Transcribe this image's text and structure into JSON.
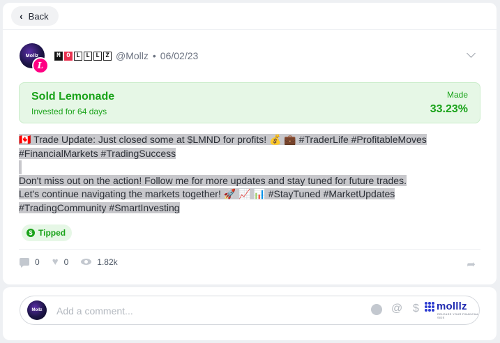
{
  "nav": {
    "back_label": "Back"
  },
  "post": {
    "author_handle": "@Mollz",
    "separator": "•",
    "date": "06/02/23",
    "name_glyphs": [
      "M",
      "O",
      "L",
      "L",
      "L",
      "Z"
    ],
    "avatar_text": "Mollz"
  },
  "result": {
    "title": "Sold Lemonade",
    "subtitle": "Invested for 64 days",
    "made_label": "Made",
    "made_value": "33.23%"
  },
  "body": {
    "line1": "🇨🇦 Trade Update: Just closed some at $LMND for profits! 💰 💼 #TraderLife #ProfitableMoves",
    "line2": "#FinancialMarkets #TradingSuccess",
    "line3": "Don't miss out on the action! Follow me for more updates and stay tuned for future trades.",
    "line4": "Let's continue navigating the markets together! 🚀 📈 📊 #StayTuned #MarketUpdates",
    "line5": "#TradingCommunity #SmartInvesting"
  },
  "tip": {
    "label": "Tipped",
    "icon": "dollar-icon"
  },
  "stats": {
    "comments": "0",
    "likes": "0",
    "views": "1.82k"
  },
  "comment": {
    "placeholder": "Add a comment...",
    "brand_name": "molllz",
    "brand_tagline": "RELEASE YOUR FINANCIAL SIDE"
  },
  "colors": {
    "accent_green": "#1aa31a",
    "brand_pink": "#ff0083",
    "brand_blue": "#1f2ab0"
  }
}
